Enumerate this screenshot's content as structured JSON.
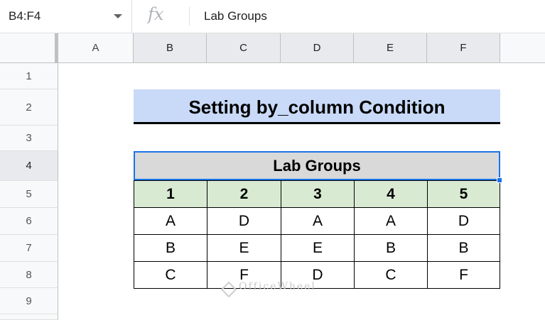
{
  "formula_bar": {
    "name_box": "B4:F4",
    "fx_label": "fx",
    "formula": "Lab Groups"
  },
  "columns": [
    "A",
    "B",
    "C",
    "D",
    "E",
    "F"
  ],
  "rows": [
    "1",
    "2",
    "3",
    "4",
    "5",
    "6",
    "7",
    "8",
    "9"
  ],
  "title": "Setting by_column Condition",
  "table": {
    "header": "Lab Groups",
    "group_numbers": [
      "1",
      "2",
      "3",
      "4",
      "5"
    ],
    "rows": [
      [
        "A",
        "D",
        "A",
        "A",
        "D"
      ],
      [
        "B",
        "E",
        "E",
        "B",
        "B"
      ],
      [
        "C",
        "F",
        "D",
        "C",
        "F"
      ]
    ]
  },
  "watermark": "OfficeWheel",
  "colors": {
    "title_bg": "#c9daf8",
    "table_header_bg": "#d9d9d9",
    "group_row_bg": "#d9ead3",
    "selection": "#1a73e8"
  }
}
